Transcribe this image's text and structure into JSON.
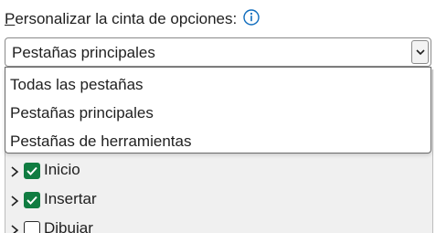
{
  "header": {
    "label_accel": "P",
    "label_rest": "ersonalizar la cinta de opciones:",
    "info_icon": "info-circle-icon"
  },
  "combo": {
    "value": "Pestañas principales",
    "dropdown_icon": "chevron-down-icon"
  },
  "dropdown": {
    "items": [
      {
        "label": "Todas las pestañas"
      },
      {
        "label": "Pestañas principales"
      },
      {
        "label": "Pestañas de herramientas"
      }
    ]
  },
  "tree": {
    "items": [
      {
        "label": "Inicio",
        "checked": true
      },
      {
        "label": "Insertar",
        "checked": true
      },
      {
        "label": "Dibujar",
        "checked": false
      }
    ]
  },
  "colors": {
    "accent": "#0f6cbd",
    "checkbox_checked": "#107c41"
  }
}
